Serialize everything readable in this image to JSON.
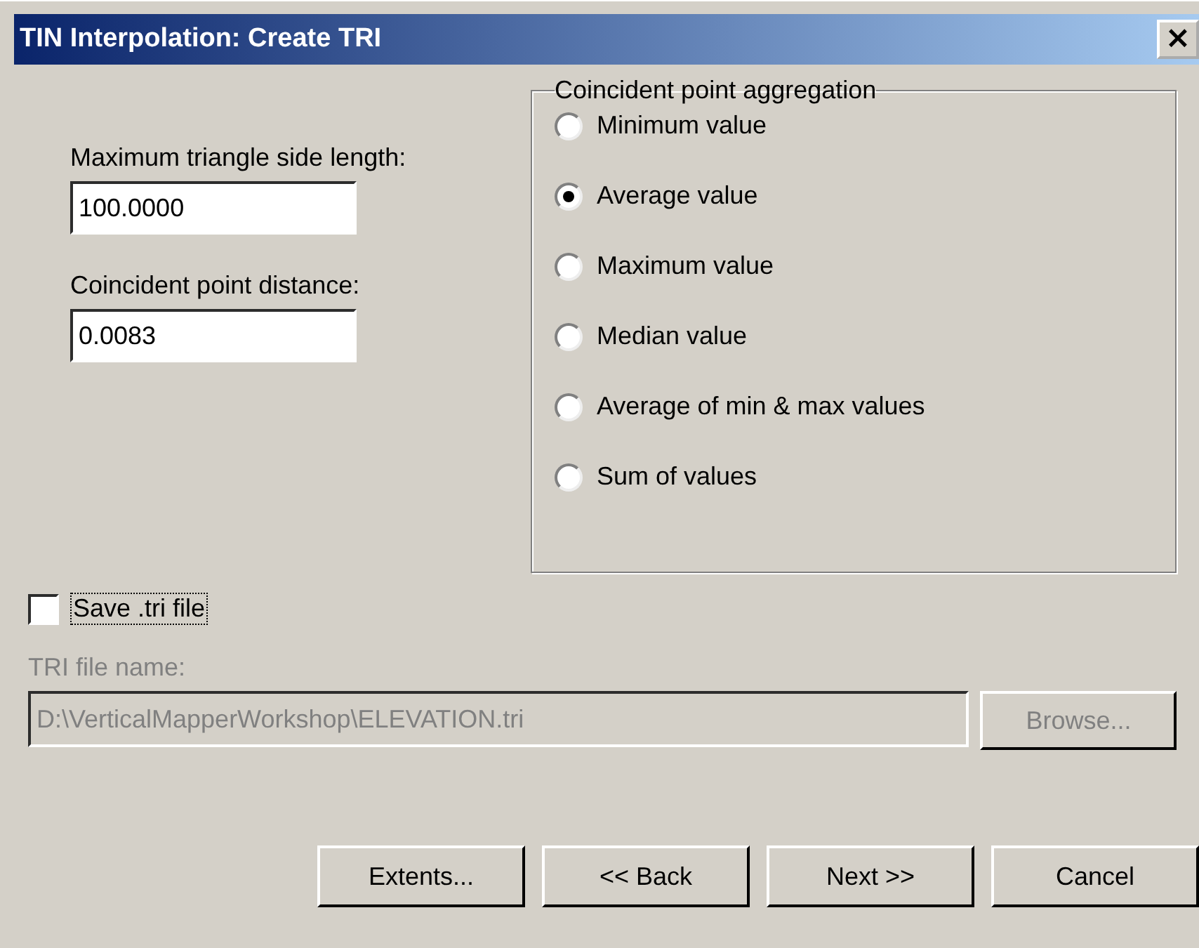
{
  "window": {
    "title": "TIN Interpolation: Create TRI",
    "close": "×"
  },
  "fields": [
    {
      "label": "Maximum triangle side length:",
      "value": "100.0000"
    },
    {
      "label": "Coincident point distance:",
      "value": "0.0083"
    }
  ],
  "aggregation": {
    "title": "Coincident point aggregation",
    "options": [
      {
        "label": "Minimum value",
        "selected": false
      },
      {
        "label": "Average value",
        "selected": true
      },
      {
        "label": "Maximum value",
        "selected": false
      },
      {
        "label": "Median value",
        "selected": false
      },
      {
        "label": "Average of min & max values",
        "selected": false
      },
      {
        "label": "Sum of values",
        "selected": false
      }
    ]
  },
  "save_tri": {
    "label": "Save .tri file",
    "checked": false
  },
  "tri_file": {
    "label": "TRI file name:",
    "value": "D:\\VerticalMapperWorkshop\\ELEVATION.tri",
    "disabled": true,
    "browse": "Browse..."
  },
  "buttons": [
    "Extents...",
    "<< Back",
    "Next >>",
    "Cancel"
  ]
}
